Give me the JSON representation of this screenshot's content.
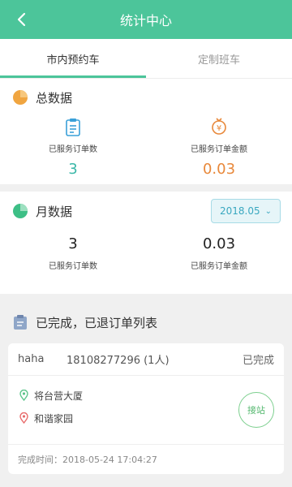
{
  "header": {
    "title": "统计中心",
    "back_icon": "back-arrow-icon"
  },
  "tabs": [
    {
      "label": "市内预约车",
      "active": true
    },
    {
      "label": "定制班车",
      "active": false
    }
  ],
  "total": {
    "title": "总数据",
    "orders_label": "已服务订单数",
    "orders_value": "3",
    "amount_label": "已服务订单金额",
    "amount_value": "0.03"
  },
  "monthly": {
    "title": "月数据",
    "month": "2018.05",
    "orders_value": "3",
    "orders_label": "已服务订单数",
    "amount_value": "0.03",
    "amount_label": "已服务订单金额"
  },
  "list": {
    "title": "已完成，已退订单列表",
    "orders": [
      {
        "name": "haha",
        "phone": "18108277296 (1人)",
        "status": "已完成",
        "from": "将台营大厦",
        "to": "和谐家园",
        "action": "接站",
        "completed_time": "完成时间：2018-05-24 17:04:27"
      }
    ]
  },
  "colors": {
    "brand": "#4cc59a",
    "teal": "#3ab7a8",
    "orange": "#e8883a"
  }
}
